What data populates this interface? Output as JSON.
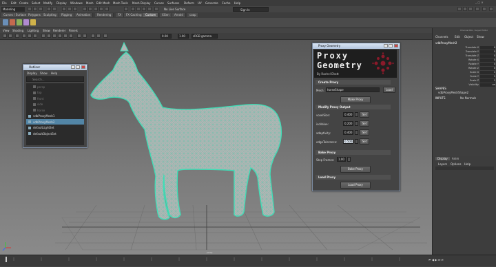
{
  "menubar": {
    "items": [
      "File",
      "Edit",
      "Create",
      "Select",
      "Modify",
      "Display",
      "Windows",
      "Mesh",
      "Edit Mesh",
      "Mesh Tools",
      "Mesh Display",
      "Curves",
      "Surfaces",
      "Deform",
      "UV",
      "Generate",
      "Cache",
      "Help"
    ],
    "sign_in": "Sign In"
  },
  "statusline": {
    "mode": "Modeling",
    "live_surface": "No Live Surface"
  },
  "shelf": {
    "tabs": [
      "Curves / Surfaces",
      "Polygons",
      "Sculpting",
      "Rigging",
      "Animation",
      "Rendering",
      "FX",
      "FX Caching",
      "Custom",
      "XGen",
      "Arnold",
      "coap"
    ],
    "active_tab": "Custom"
  },
  "panel_menu": [
    "View",
    "Shading",
    "Lighting",
    "Show",
    "Renderer",
    "Panels"
  ],
  "panel_toolbar": {
    "value1": "0.00",
    "value2": "1.00",
    "color_space": "sRGB gamma"
  },
  "viewport": {
    "camera_label": "persp"
  },
  "outliner": {
    "title": "Outliner",
    "menu": [
      "Display",
      "Show",
      "Help"
    ],
    "search_placeholder": "Search...",
    "items": [
      {
        "name": "persp",
        "dim": true
      },
      {
        "name": "top",
        "dim": true
      },
      {
        "name": "front",
        "dim": true
      },
      {
        "name": "side",
        "dim": true
      },
      {
        "name": "horse",
        "dim": true
      },
      {
        "name": "vdbProxyMesh1",
        "dim": false
      },
      {
        "name": "vdbProxyMesh2",
        "dim": false,
        "selected": true
      },
      {
        "name": "defaultLightSet",
        "dim": false
      },
      {
        "name": "defaultObjectSet",
        "dim": false
      }
    ]
  },
  "proxy": {
    "title": "Proxy Geometry",
    "header_line1": "Proxy",
    "header_line2": "Geometry",
    "author": "By Rachel Ehatt",
    "create_section": "Create Proxy",
    "mesh_label": "Mesh:",
    "mesh_value": "horseShape",
    "load_label": "Load",
    "make_proxy": "Make Proxy",
    "modify_section": "Modify Proxy Output",
    "params": [
      {
        "label": "voxelSize:",
        "value": "0.400"
      },
      {
        "label": "isoValue:",
        "value": "0.200"
      },
      {
        "label": "adaptivity:",
        "value": "0.400"
      },
      {
        "label": "edgeTolerance:",
        "value": "0.500"
      }
    ],
    "set_label": "Set",
    "bake_section": "Bake Proxy",
    "step_label": "Step Frames:",
    "step_value": "1.00",
    "bake_label": "Bake Proxy",
    "load_section": "Load Proxy",
    "load_proxy": "Load Proxy"
  },
  "channel_box": {
    "tabs": [
      "Channels",
      "Edit",
      "Object",
      "Show"
    ],
    "panel_tabs": "Channel Box / Layer Editor",
    "object_name": "vdbProxyMesh2",
    "attrs": [
      {
        "name": "Translate X",
        "value": "0"
      },
      {
        "name": "Translate Y",
        "value": "0"
      },
      {
        "name": "Translate Z",
        "value": "0"
      },
      {
        "name": "Rotate X",
        "value": "0"
      },
      {
        "name": "Rotate Y",
        "value": "0"
      },
      {
        "name": "Rotate Z",
        "value": "0"
      },
      {
        "name": "Scale X",
        "value": "1"
      },
      {
        "name": "Scale Y",
        "value": "1"
      },
      {
        "name": "Scale Z",
        "value": "1"
      },
      {
        "name": "Visibility",
        "value": "on"
      }
    ],
    "shapes_header": "SHAPES",
    "shape_name": "vdbProxyMeshShape2",
    "inputs_header": "INPUTS",
    "inputs_name": "No Normals"
  },
  "layer_editor": {
    "tabs": [
      "Display",
      "Anim"
    ],
    "menu": [
      "Layers",
      "Options",
      "Help"
    ]
  }
}
